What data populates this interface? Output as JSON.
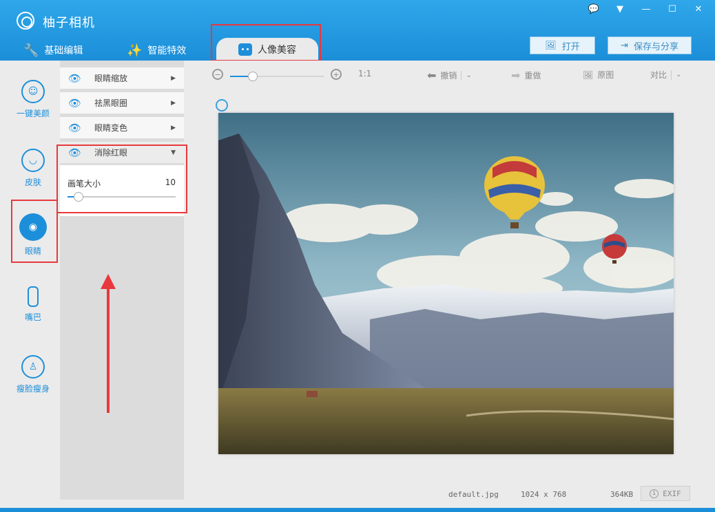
{
  "app": {
    "title": "柚子相机"
  },
  "window_controls": {
    "feedback": "💬",
    "menu": "▼",
    "minimize": "—",
    "maximize": "☐",
    "close": "✕"
  },
  "main_tabs": [
    {
      "label": "基础编辑",
      "icon": "tools-icon"
    },
    {
      "label": "智能特效",
      "icon": "magic-wand-icon"
    },
    {
      "label": "人像美容",
      "icon": "face-box-icon",
      "active": true
    }
  ],
  "header_buttons": {
    "open": "打开",
    "save_share": "保存与分享"
  },
  "left_nav": [
    {
      "label": "一键美颜",
      "icon": "face-beauty-icon"
    },
    {
      "label": "皮肤",
      "icon": "skin-face-icon"
    },
    {
      "label": "眼睛",
      "icon": "eye-star-icon",
      "active": true
    },
    {
      "label": "嘴巴",
      "icon": "lipstick-icon"
    },
    {
      "label": "瘦脸瘦身",
      "icon": "body-slim-icon"
    }
  ],
  "sub_menu": [
    {
      "label": "眼睛缩放",
      "icon": "eye-zoom-icon"
    },
    {
      "label": "祛黑眼圈",
      "icon": "eye-dark-circle-icon"
    },
    {
      "label": "眼睛变色",
      "icon": "eye-color-icon"
    },
    {
      "label": "消除红眼",
      "icon": "eye-redeye-icon",
      "expanded": true
    }
  ],
  "redeye": {
    "brush_label": "画笔大小",
    "brush_value": "10",
    "brush_fraction": 0.1
  },
  "toolbar": {
    "zoom_ratio": "1:1",
    "zoom_fraction": 0.24,
    "undo": "撤销",
    "redo": "重做",
    "original": "原图",
    "compare": "对比"
  },
  "status": {
    "filename": "default.jpg",
    "dimensions": "1024 x 768",
    "filesize": "364KB",
    "exif": "EXIF"
  },
  "colors": {
    "accent": "#1d8fda",
    "header": "#2fa7ea",
    "highlight": "#e8383d"
  }
}
